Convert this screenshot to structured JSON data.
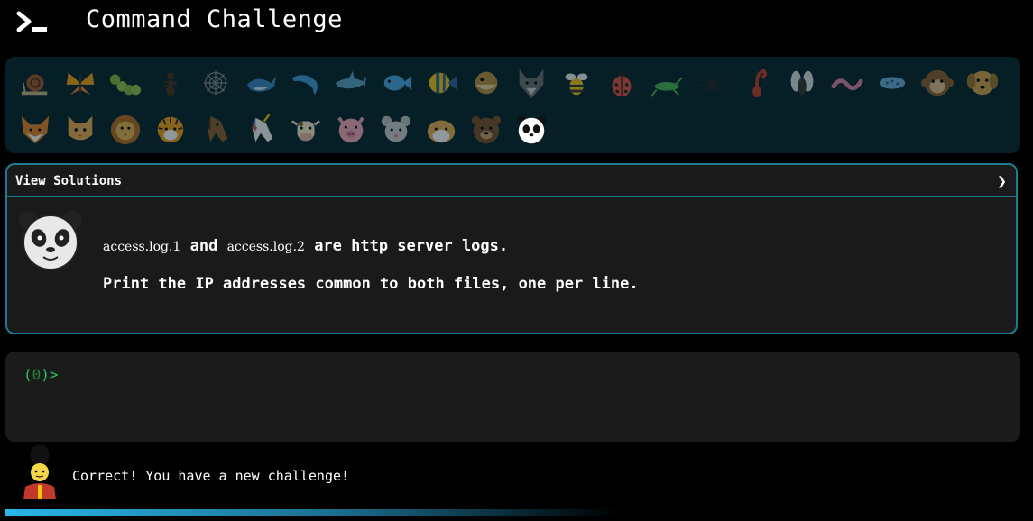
{
  "header": {
    "title": "Command Challenge"
  },
  "animals": [
    {
      "name": "snail"
    },
    {
      "name": "butterfly"
    },
    {
      "name": "caterpillar"
    },
    {
      "name": "ant"
    },
    {
      "name": "spider-web"
    },
    {
      "name": "whale"
    },
    {
      "name": "dolphin"
    },
    {
      "name": "shark"
    },
    {
      "name": "fish"
    },
    {
      "name": "tropical-fish"
    },
    {
      "name": "blowfish"
    },
    {
      "name": "wolf"
    },
    {
      "name": "bee"
    },
    {
      "name": "ladybug"
    },
    {
      "name": "cricket"
    },
    {
      "name": "spider"
    },
    {
      "name": "scorpion"
    },
    {
      "name": "fly"
    },
    {
      "name": "worm"
    },
    {
      "name": "microbe"
    },
    {
      "name": "monkey"
    },
    {
      "name": "dog"
    },
    {
      "name": "fox"
    },
    {
      "name": "cat"
    },
    {
      "name": "lion"
    },
    {
      "name": "tiger"
    },
    {
      "name": "horse"
    },
    {
      "name": "unicorn"
    },
    {
      "name": "cow"
    },
    {
      "name": "pig"
    },
    {
      "name": "mouse"
    },
    {
      "name": "hamster"
    },
    {
      "name": "bear"
    },
    {
      "name": "panda"
    }
  ],
  "solutions": {
    "header_label": "View Solutions",
    "chevron": "❯"
  },
  "challenge": {
    "file1": "access.log.1",
    "and": "and",
    "file2": "access.log.2",
    "are_text": "are http server logs.",
    "line2": "Print the IP addresses common to both files, one per line."
  },
  "terminal": {
    "prompt_open": "(",
    "prompt_count": "0",
    "prompt_close": ")>"
  },
  "status": {
    "message": "Correct! You have a new challenge!"
  },
  "colors": {
    "accent": "#1f7a8c",
    "prompt": "#22c55e",
    "progress": "#29b6e8"
  }
}
